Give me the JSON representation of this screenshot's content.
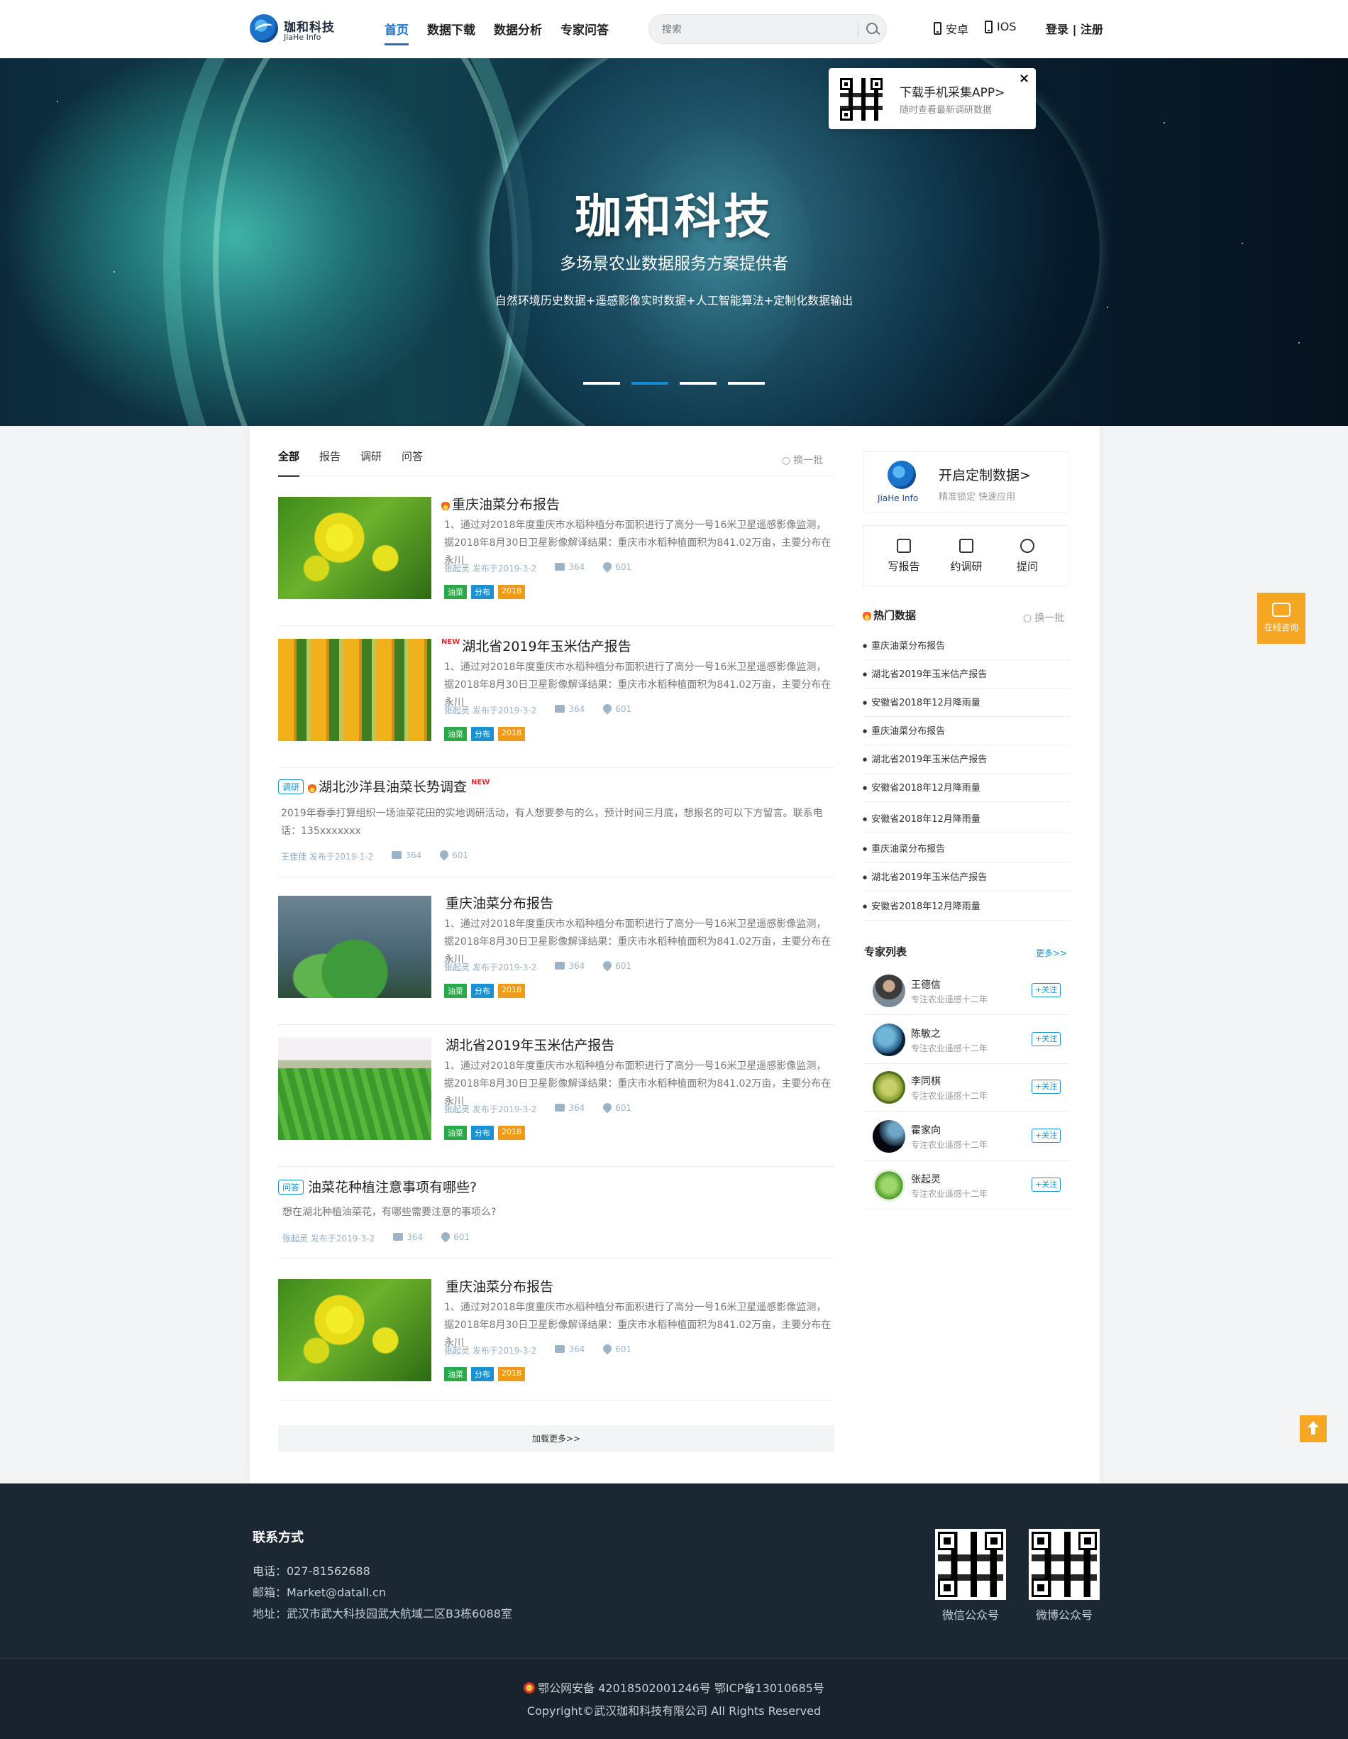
{
  "header": {
    "logo_cn": "珈和科技",
    "logo_en": "JiaHe Info",
    "nav": [
      "首页",
      "数据下载",
      "数据分析",
      "专家问答"
    ],
    "search_placeholder": "搜索",
    "android": "安卓",
    "ios": "IOS",
    "login": "登录 | 注册"
  },
  "banner": {
    "title": "珈和科技",
    "subtitle": "多场景农业数据服务方案提供者",
    "desc": "自然环境历史数据+遥感影像实时数据+人工智能算法+定制化数据输出",
    "active_slide": 2,
    "slide_count": 4
  },
  "app_popup": {
    "title": "下载手机采集APP>",
    "sub": "随时查看最新调研数据",
    "close": "×"
  },
  "feed": {
    "tabs": [
      "全部",
      "报告",
      "调研",
      "问答"
    ],
    "refresh": "换一批",
    "load_more": "加载更多>>",
    "items": [
      {
        "title": "重庆油菜分布报告",
        "desc": "1、通过对2018年度重庆市水稻种植分布面积进行了高分一号16米卫星遥感影像监测，据2018年8月30日卫星影像解译结果：重庆市水稻种植面积为841.02万亩，主要分布在永川",
        "author": "张起灵",
        "date": "发布于2019-3-2",
        "comments": "364",
        "likes": "601",
        "tags": [
          "油菜",
          "分布",
          "2018"
        ],
        "badge": "fire"
      },
      {
        "title": "湖北省2019年玉米估产报告",
        "desc": "1、通过对2018年度重庆市水稻种植分布面积进行了高分一号16米卫星遥感影像监测，据2018年8月30日卫星影像解译结果：重庆市水稻种植面积为841.02万亩，主要分布在永川",
        "author": "张起灵",
        "date": "发布于2019-3-2",
        "comments": "364",
        "likes": "601",
        "tags": [
          "油菜",
          "分布",
          "2018"
        ],
        "badge": "NEW"
      },
      {
        "type": "调研",
        "title": "湖北沙洋县油菜长势调查",
        "new": "NEW",
        "desc": "2019年春季打算组织一场油菜花田的实地调研活动，有人想要参与的么，预计时间三月底，想报名的可以下方留言。联系电话：135xxxxxxx",
        "author": "王佳佳",
        "date": "发布于2019-1-2",
        "comments": "364",
        "likes": "601"
      },
      {
        "title": "重庆油菜分布报告",
        "desc": "1、通过对2018年度重庆市水稻种植分布面积进行了高分一号16米卫星遥感影像监测，据2018年8月30日卫星影像解译结果：重庆市水稻种植面积为841.02万亩，主要分布在永川",
        "author": "张起灵",
        "date": "发布于2019-3-2",
        "comments": "364",
        "likes": "601",
        "tags": [
          "油菜",
          "分布",
          "2018"
        ]
      },
      {
        "title": "湖北省2019年玉米估产报告",
        "desc": "1、通过对2018年度重庆市水稻种植分布面积进行了高分一号16米卫星遥感影像监测，据2018年8月30日卫星影像解译结果：重庆市水稻种植面积为841.02万亩，主要分布在永川",
        "author": "张起灵",
        "date": "发布于2019-3-2",
        "comments": "364",
        "likes": "601",
        "tags": [
          "油菜",
          "分布",
          "2018"
        ]
      },
      {
        "type": "问答",
        "title": "油菜花种植注意事项有哪些?",
        "desc": "想在湖北种植油菜花，有哪些需要注意的事项么?",
        "author": "张起灵",
        "date": "发布于2019-3-2",
        "comments": "364",
        "likes": "601"
      },
      {
        "title": "重庆油菜分布报告",
        "desc": "1、通过对2018年度重庆市水稻种植分布面积进行了高分一号16米卫星遥感影像监测，据2018年8月30日卫星影像解译结果：重庆市水稻种植面积为841.02万亩，主要分布在永川",
        "author": "张起灵",
        "date": "发布于2019-3-2",
        "comments": "364",
        "likes": "601",
        "tags": [
          "油菜",
          "分布",
          "2018"
        ]
      }
    ]
  },
  "sidebar": {
    "custom_title": "开启定制数据>",
    "custom_sub": "精准锁定  快速应用",
    "logo_en": "JiaHe Info",
    "actions": [
      "写报告",
      "约调研",
      "提问"
    ],
    "hot_title": "热门数据",
    "hot_refresh": "换一批",
    "hot_items": [
      "重庆油菜分布报告",
      "湖北省2019年玉米估产报告",
      "安徽省2018年12月降雨量",
      "重庆油菜分布报告",
      "湖北省2019年玉米估产报告",
      "安徽省2018年12月降雨量",
      "安徽省2018年12月降雨量",
      "重庆油菜分布报告",
      "湖北省2019年玉米估产报告",
      "安徽省2018年12月降雨量"
    ],
    "expert_title": "专家列表",
    "expert_more": "更多>>",
    "experts": [
      {
        "name": "王德信",
        "desc": "专注农业遥感十二年",
        "follow": "+关注"
      },
      {
        "name": "陈敏之",
        "desc": "专注农业遥感十二年",
        "follow": "+关注"
      },
      {
        "name": "李同棋",
        "desc": "专注农业遥感十二年",
        "follow": "+关注"
      },
      {
        "name": "霍家向",
        "desc": "专注农业遥感十二年",
        "follow": "+关注"
      },
      {
        "name": "张起灵",
        "desc": "专注农业遥感十二年",
        "follow": "+关注"
      }
    ]
  },
  "float": {
    "consult": "在线咨询"
  },
  "footer": {
    "contact_title": "联系方式",
    "phone": "电话：027-81562688",
    "email": "邮箱：Market@datall.cn",
    "address": "地址：武汉市武大科技园武大航域二区B3栋6088室",
    "qr_wechat": "微信公众号",
    "qr_weibo": "微博公众号",
    "icp_line": "鄂公网安备 42018502001246号   鄂ICP备13010685号",
    "copyright": "Copyright©武汉珈和科技有限公司 All Rights Reserved"
  }
}
